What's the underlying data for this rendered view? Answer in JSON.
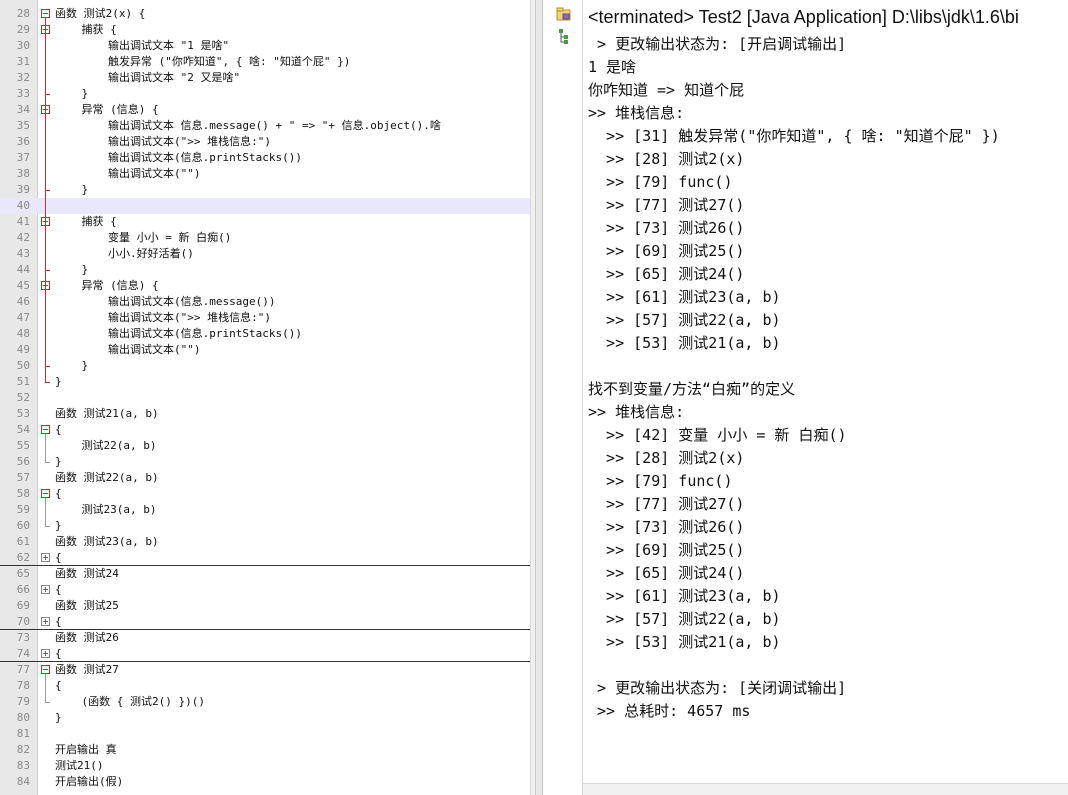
{
  "editor": {
    "lines": [
      {
        "n": "28",
        "text": "函数 测试2(x) {"
      },
      {
        "n": "29",
        "text": "    捕获 {"
      },
      {
        "n": "30",
        "text": "        输出调试文本 \"1 是啥\""
      },
      {
        "n": "31",
        "text": "        触发异常 (\"你咋知道\", { 啥: \"知道个屁\" })"
      },
      {
        "n": "32",
        "text": "        输出调试文本 \"2 又是啥\""
      },
      {
        "n": "33",
        "text": "    }"
      },
      {
        "n": "34",
        "text": "    异常 (信息) {"
      },
      {
        "n": "35",
        "text": "        输出调试文本 信息.message() + \" => \"+ 信息.object().啥"
      },
      {
        "n": "36",
        "text": "        输出调试文本(\">> 堆栈信息:\")"
      },
      {
        "n": "37",
        "text": "        输出调试文本(信息.printStacks())"
      },
      {
        "n": "38",
        "text": "        输出调试文本(\"\")"
      },
      {
        "n": "39",
        "text": "    }"
      },
      {
        "n": "40",
        "text": ""
      },
      {
        "n": "41",
        "text": "    捕获 {"
      },
      {
        "n": "42",
        "text": "        变量 小小 = 新 白痴()"
      },
      {
        "n": "43",
        "text": "        小小.好好活着()"
      },
      {
        "n": "44",
        "text": "    }"
      },
      {
        "n": "45",
        "text": "    异常 (信息) {"
      },
      {
        "n": "46",
        "text": "        输出调试文本(信息.message())"
      },
      {
        "n": "47",
        "text": "        输出调试文本(\">> 堆栈信息:\")"
      },
      {
        "n": "48",
        "text": "        输出调试文本(信息.printStacks())"
      },
      {
        "n": "49",
        "text": "        输出调试文本(\"\")"
      },
      {
        "n": "50",
        "text": "    }"
      },
      {
        "n": "51",
        "text": "}"
      },
      {
        "n": "52",
        "text": ""
      },
      {
        "n": "53",
        "text": "函数 测试21(a, b)"
      },
      {
        "n": "54",
        "text": "{"
      },
      {
        "n": "55",
        "text": "    测试22(a, b)"
      },
      {
        "n": "56",
        "text": "}"
      },
      {
        "n": "57",
        "text": "函数 测试22(a, b)"
      },
      {
        "n": "58",
        "text": "{"
      },
      {
        "n": "59",
        "text": "    测试23(a, b)"
      },
      {
        "n": "60",
        "text": "}"
      },
      {
        "n": "61",
        "text": "函数 测试23(a, b)"
      },
      {
        "n": "62",
        "text": "{"
      },
      {
        "n": "65",
        "text": "函数 测试24"
      },
      {
        "n": "66",
        "text": "{"
      },
      {
        "n": "69",
        "text": "函数 测试25"
      },
      {
        "n": "70",
        "text": "{"
      },
      {
        "n": "73",
        "text": "函数 测试26"
      },
      {
        "n": "74",
        "text": "{"
      },
      {
        "n": "77",
        "text": "函数 测试27"
      },
      {
        "n": "78",
        "text": "{"
      },
      {
        "n": "79",
        "text": "    (函数 { 测试2() })()"
      },
      {
        "n": "80",
        "text": "}"
      },
      {
        "n": "81",
        "text": ""
      },
      {
        "n": "82",
        "text": "开启输出 真"
      },
      {
        "n": "83",
        "text": "测试21()"
      },
      {
        "n": "84",
        "text": "开启输出(假)"
      }
    ]
  },
  "console": {
    "title": "<terminated> Test2 [Java Application] D:\\libs\\jdk\\1.6\\bi",
    "lines": [
      " > 更改输出状态为: [开启调试输出]",
      "1 是啥",
      "你咋知道 => 知道个屁",
      ">> 堆栈信息:",
      "  >> [31] 触发异常(\"你咋知道\", { 啥: \"知道个屁\" })",
      "  >> [28] 测试2(x)",
      "  >> [79] func()",
      "  >> [77] 测试27()",
      "  >> [73] 测试26()",
      "  >> [69] 测试25()",
      "  >> [65] 测试24()",
      "  >> [61] 测试23(a, b)",
      "  >> [57] 测试22(a, b)",
      "  >> [53] 测试21(a, b)",
      "",
      "找不到变量/方法“白痴”的定义",
      ">> 堆栈信息:",
      "  >> [42] 变量 小小 = 新 白痴()",
      "  >> [28] 测试2(x)",
      "  >> [79] func()",
      "  >> [77] 测试27()",
      "  >> [73] 测试26()",
      "  >> [69] 测试25()",
      "  >> [65] 测试24()",
      "  >> [61] 测试23(a, b)",
      "  >> [57] 测试22(a, b)",
      "  >> [53] 测试21(a, b)",
      "",
      " > 更改输出状态为: [关闭调试输出]",
      " >> 总耗时: 4657 ms"
    ]
  },
  "toolbar": {
    "icons": [
      "package-explorer-icon",
      "hierarchy-icon"
    ]
  },
  "colors": {
    "fold_marker": "#c03030",
    "current_line": "#e8e8fa",
    "gutter": "#e8e8e8"
  }
}
